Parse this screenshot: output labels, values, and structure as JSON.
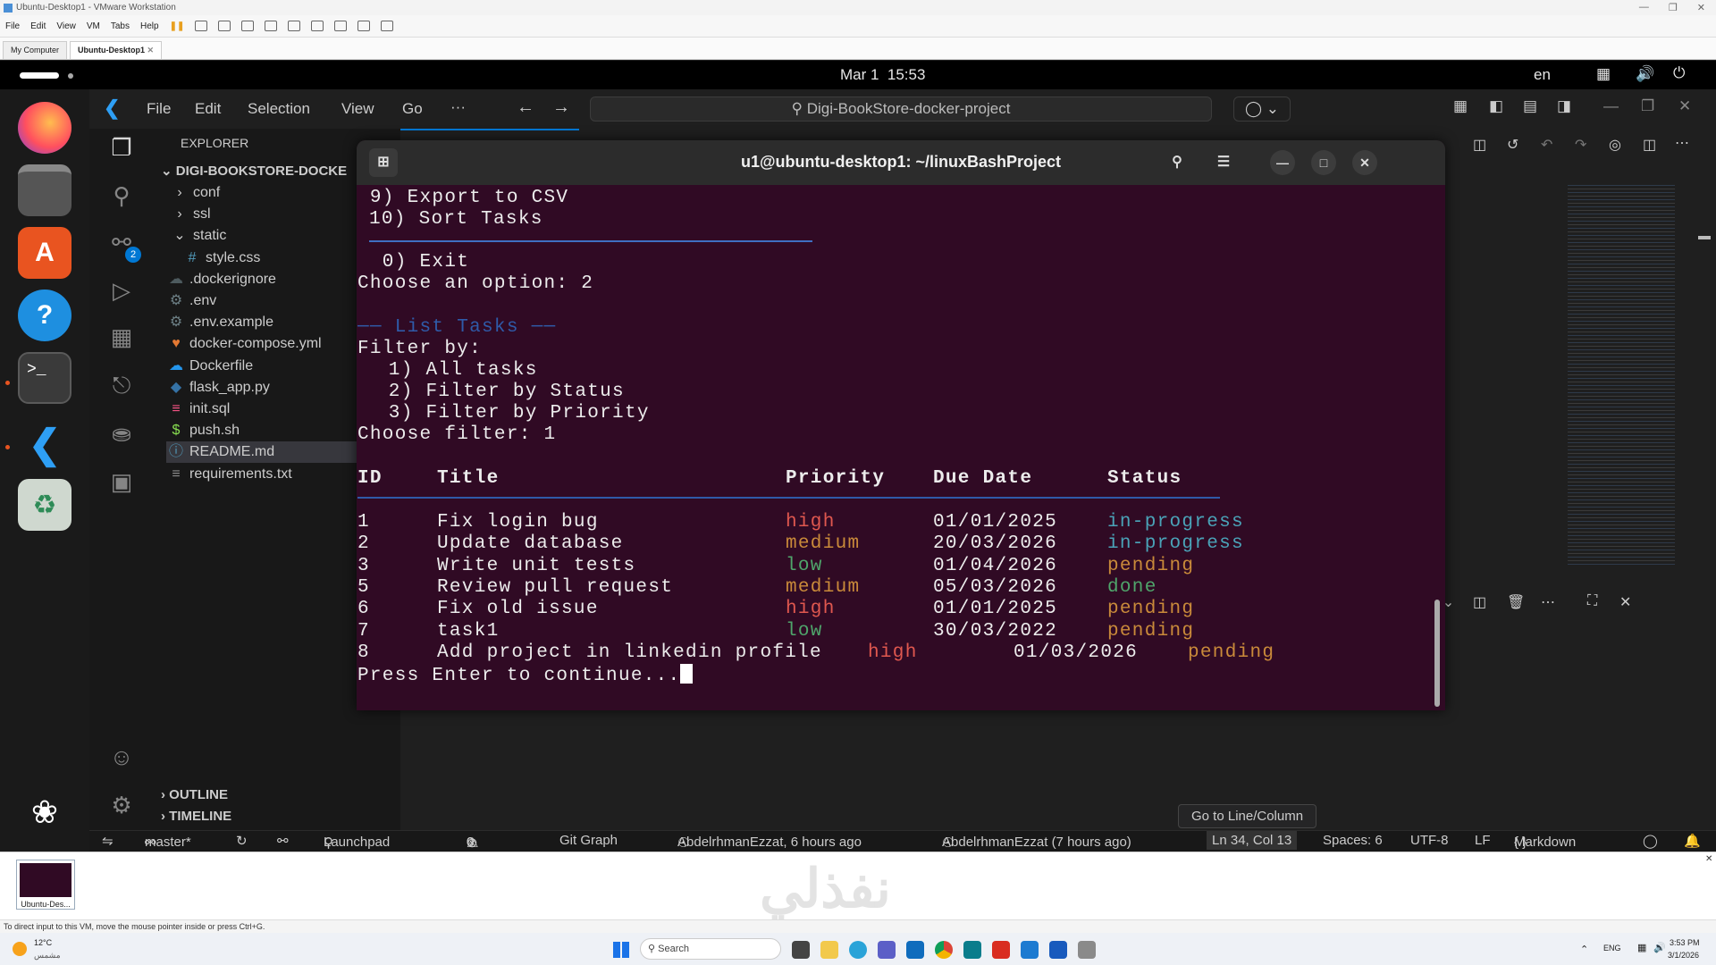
{
  "vmware": {
    "title": "Ubuntu-Desktop1 - VMware Workstation",
    "menu": [
      "File",
      "Edit",
      "View",
      "VM",
      "Tabs",
      "Help"
    ],
    "tabs": [
      "My Computer",
      "Ubuntu-Desktop1"
    ],
    "thumb_label": "Ubuntu-Des...",
    "hint": "To direct input to this VM, move the mouse pointer inside or press Ctrl+G."
  },
  "ubuntu": {
    "datetime": "Mar 1  15:53",
    "lang": "en"
  },
  "vscode": {
    "menu": [
      "File",
      "Edit",
      "Selection",
      "View",
      "Go",
      "···"
    ],
    "search": "Digi-BookStore-docker-project",
    "explorer_label": "EXPLORER",
    "project_root": "DIGI-BOOKSTORE-DOCKE",
    "tree": [
      {
        "name": "conf",
        "kind": "folder",
        "icon": "›",
        "color": "#cccccc"
      },
      {
        "name": "ssl",
        "kind": "folder",
        "icon": "›",
        "color": "#cccccc"
      },
      {
        "name": "static",
        "kind": "folder-open",
        "icon": "⌄",
        "color": "#cccccc"
      },
      {
        "name": "style.css",
        "kind": "file",
        "icon": "#",
        "color": "#519aba"
      },
      {
        "name": ".dockerignore",
        "kind": "file",
        "icon": "☁",
        "color": "#4d5a5e"
      },
      {
        "name": ".env",
        "kind": "file",
        "icon": "⚙",
        "color": "#6d8086"
      },
      {
        "name": ".env.example",
        "kind": "file",
        "icon": "⚙",
        "color": "#6d8086"
      },
      {
        "name": "docker-compose.yml",
        "kind": "file",
        "icon": "♥",
        "color": "#e37933"
      },
      {
        "name": "Dockerfile",
        "kind": "file",
        "icon": "☁",
        "color": "#2496ed"
      },
      {
        "name": "flask_app.py",
        "kind": "file",
        "icon": "◆",
        "color": "#3572a5"
      },
      {
        "name": "init.sql",
        "kind": "file",
        "icon": "≡",
        "color": "#f55385"
      },
      {
        "name": "push.sh",
        "kind": "file",
        "icon": "$",
        "color": "#89e051"
      },
      {
        "name": "README.md",
        "kind": "file",
        "icon": "ⓘ",
        "color": "#519aba"
      },
      {
        "name": "requirements.txt",
        "kind": "file",
        "icon": "≡",
        "color": "#8a8a8a"
      }
    ],
    "outline_label": "OUTLINE",
    "timeline_label": "TIMELINE",
    "scm_badge": "2",
    "goto_tooltip": "Go to Line/Column",
    "status": {
      "branch": "master*",
      "launchpad": "Launchpad",
      "errors": "0",
      "warnings": "0",
      "git_graph": "Git Graph",
      "blame1": "AbdelrhmanEzzat, 6 hours ago",
      "blame2": "AbdelrhmanEzzat (7 hours ago)",
      "cursor": "Ln 34, Col 13",
      "spaces": "Spaces: 6",
      "encoding": "UTF-8",
      "eol": "LF",
      "language": "Markdown"
    }
  },
  "terminal": {
    "title": "u1@ubuntu-desktop1: ~/linuxBashProject",
    "lines": {
      "opt9": " 9) Export to CSV",
      "opt10": "10) Sort Tasks",
      "exit": "  0) Exit",
      "choose": "Choose an option: 2",
      "list_header": "── List Tasks ──",
      "filter_by": "Filter by:",
      "f1": "  1) All tasks",
      "f2": "  2) Filter by Status",
      "f3": "  3) Filter by Priority",
      "choose_filter": "Choose filter: 1",
      "press": "Press Enter to continue..."
    },
    "columns": [
      "ID",
      "Title",
      "Priority",
      "Due Date",
      "Status"
    ],
    "rows": [
      {
        "id": "1",
        "title": "Fix login bug",
        "priority": "high",
        "due": "01/01/2025",
        "status": "in-progress"
      },
      {
        "id": "2",
        "title": "Update database",
        "priority": "medium",
        "due": "20/03/2026",
        "status": "in-progress"
      },
      {
        "id": "3",
        "title": "Write unit tests",
        "priority": "low",
        "due": "01/04/2026",
        "status": "pending"
      },
      {
        "id": "5",
        "title": "Review pull request",
        "priority": "medium",
        "due": "05/03/2026",
        "status": "done"
      },
      {
        "id": "6",
        "title": "Fix old issue",
        "priority": "high",
        "due": "01/01/2025",
        "status": "pending"
      },
      {
        "id": "7",
        "title": "task1",
        "priority": "low",
        "due": "30/03/2022",
        "status": "pending"
      },
      {
        "id": "8",
        "title": "Add project in linkedin profile",
        "priority": "high",
        "due": "01/03/2026",
        "status": "pending"
      }
    ],
    "colors": {
      "high": "#e0584f",
      "medium": "#c98a3a",
      "low": "#4fa56b",
      "in-progress": "#4aa3b8",
      "pending": "#c98a3a",
      "done": "#4fa56b",
      "header_rule": "#2f5aa8"
    }
  },
  "windows": {
    "weather_temp": "12°C",
    "weather_text": "مشمس",
    "search": "Search",
    "lang": "ENG",
    "time": "3:53 PM",
    "date": "3/1/2026"
  },
  "watermark": "نفذلي"
}
